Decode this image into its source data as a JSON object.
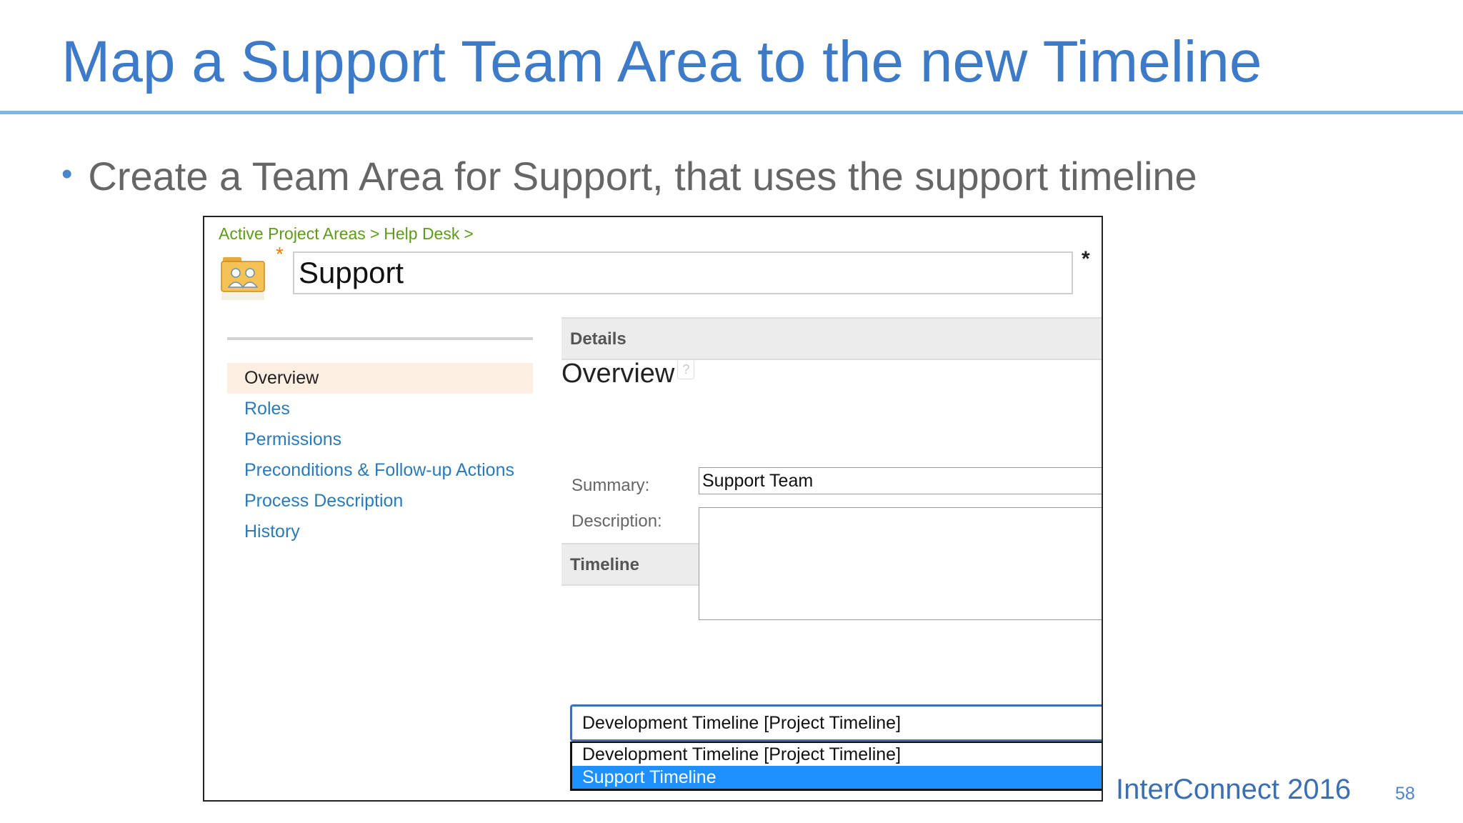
{
  "slide": {
    "title": "Map a Support Team Area to the new Timeline",
    "bullet": "Create a Team Area for Support, that uses the support timeline",
    "brand": "InterConnect 2016",
    "page_number": "58"
  },
  "app": {
    "breadcrumb": [
      "Active Project Areas",
      ">",
      "Help Desk",
      ">"
    ],
    "team_icon": "team-folder-icon",
    "name_value": "Support",
    "required_mark": "*",
    "nav": [
      {
        "label": "Overview",
        "active": true
      },
      {
        "label": "Roles",
        "active": false
      },
      {
        "label": "Permissions",
        "active": false
      },
      {
        "label": "Preconditions & Follow-up Actions",
        "active": false
      },
      {
        "label": "Process Description",
        "active": false
      },
      {
        "label": "History",
        "active": false
      }
    ],
    "overview_title": "Overview",
    "help_icon_glyph": "?",
    "details_label": "Details",
    "summary_label": "Summary:",
    "summary_value": "Support Team",
    "description_label": "Description:",
    "description_value": "",
    "timeline_label": "Timeline",
    "timeline_selected": "Development Timeline [Project Timeline]",
    "timeline_options": [
      {
        "label": "Development Timeline [Project Timeline]",
        "highlighted": false
      },
      {
        "label": "Support Timeline",
        "highlighted": true
      }
    ]
  },
  "colors": {
    "title_blue": "#3d7bc8",
    "rule_blue": "#7ab8ea",
    "link_blue": "#2c7ab8",
    "breadcrumb_green": "#5f9a1a",
    "active_nav_bg": "#fdf0e2",
    "selection_blue": "#1e90ff"
  }
}
